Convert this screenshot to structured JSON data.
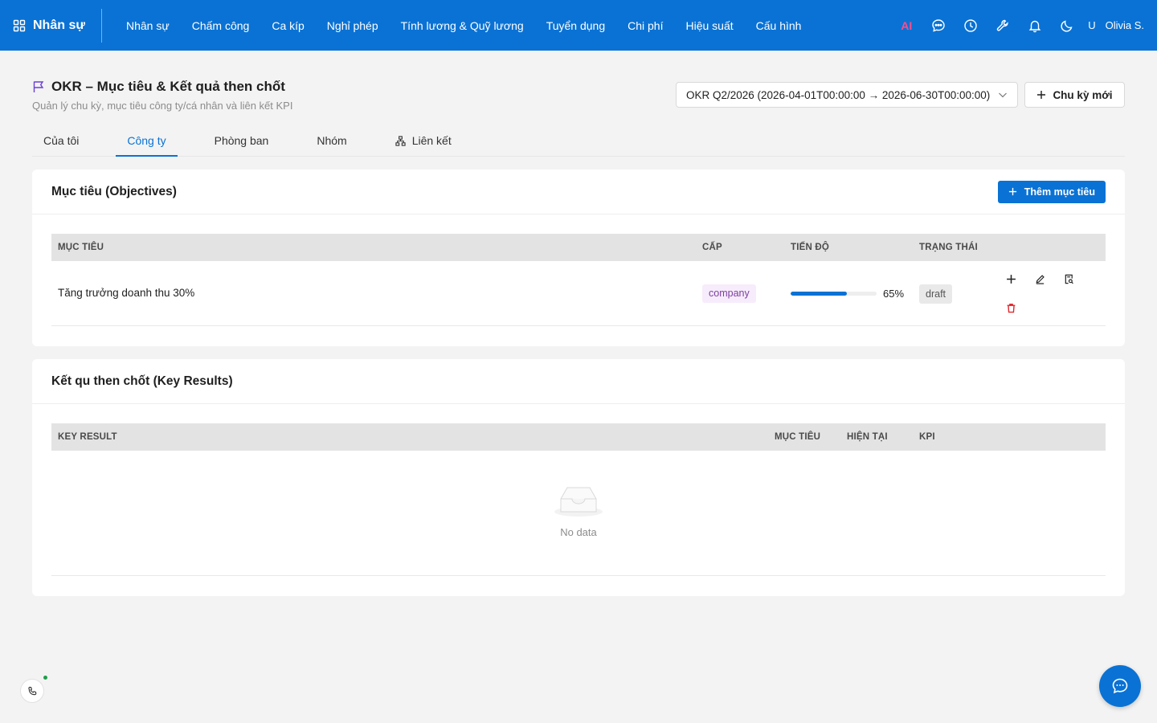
{
  "app": {
    "brand": "Nhân sự",
    "nav": [
      "Nhân sự",
      "Chấm công",
      "Ca kíp",
      "Nghỉ phép",
      "Tính lương & Quỹ lương",
      "Tuyển dụng",
      "Chi phí",
      "Hiệu suất",
      "Cấu hình"
    ],
    "ai_label": "AI",
    "user_initial": "U",
    "user_name": "Olivia S."
  },
  "page": {
    "title": "OKR – Mục tiêu & Kết quả then chốt",
    "subtitle": "Quản lý chu kỳ, mục tiêu công ty/cá nhân và liên kết KPI",
    "cycle_value": "OKR Q2/2026 (2026-04-01T00:00:00 → 2026-06-30T00:00:00)",
    "new_cycle_label": "Chu kỳ mới"
  },
  "tabs": [
    {
      "label": "Của tôi",
      "active": false
    },
    {
      "label": "Công ty",
      "active": true
    },
    {
      "label": "Phòng ban",
      "active": false
    },
    {
      "label": "Nhóm",
      "active": false
    },
    {
      "label": "Liên kết",
      "active": false
    }
  ],
  "objectives": {
    "title": "Mục tiêu (Objectives)",
    "add_label": "Thêm mục tiêu",
    "columns": [
      "MỤC TIÊU",
      "CẤP",
      "TIẾN ĐỘ",
      "TRẠNG THÁI"
    ],
    "rows": [
      {
        "name": "Tăng trưởng doanh thu 30%",
        "level": "company",
        "progress": 65,
        "progress_label": "65%",
        "status": "draft"
      }
    ]
  },
  "key_results": {
    "title": "Kết qu then chốt (Key Results)",
    "columns": [
      "KEY RESULT",
      "MỤC TIÊU",
      "HIỆN TẠI",
      "KPI"
    ],
    "empty_text": "No data"
  },
  "colors": {
    "primary": "#0a72d4",
    "ai": "#ff4d8a",
    "delete": "#e0282e",
    "level_tag_bg": "#f7ecfb",
    "online": "#1e9e4a"
  }
}
